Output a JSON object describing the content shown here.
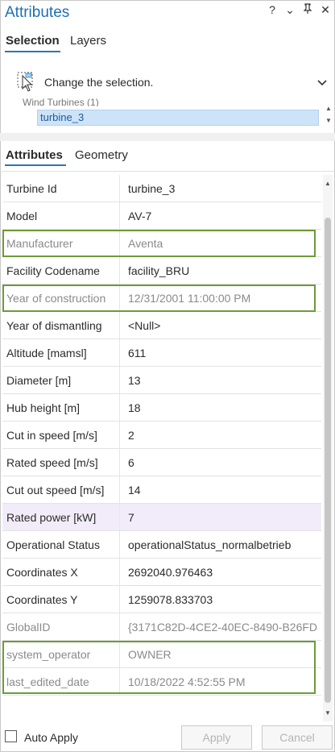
{
  "panel": {
    "title": "Attributes",
    "title_icons": [
      "help-icon",
      "dropdown-icon",
      "pin-icon",
      "close-icon"
    ],
    "help_symbol": "?",
    "dropdown_symbol": "⌄",
    "pin_symbol": "⊓",
    "close_symbol": "✕"
  },
  "top_tabs": [
    {
      "label": "Selection",
      "active": true
    },
    {
      "label": "Layers",
      "active": false
    }
  ],
  "selection": {
    "change_label": "Change the selection.",
    "chevron": "⌄",
    "tree_parent": "Wind Turbines (1)",
    "tree_child": "turbine_3"
  },
  "sub_tabs": [
    {
      "label": "Attributes",
      "active": true
    },
    {
      "label": "Geometry",
      "active": false
    }
  ],
  "attributes": [
    {
      "name": "Turbine Id",
      "value": "turbine_3",
      "readonly": false
    },
    {
      "name": "Model",
      "value": "AV-7",
      "readonly": false
    },
    {
      "name": "Manufacturer",
      "value": "Aventa",
      "readonly": true
    },
    {
      "name": "Facility Codename",
      "value": "facility_BRU",
      "readonly": false
    },
    {
      "name": "Year of construction",
      "value": "12/31/2001 11:00:00 PM",
      "readonly": true
    },
    {
      "name": "Year of dismantling",
      "value": "<Null>",
      "readonly": false
    },
    {
      "name": "Altitude [mamsl]",
      "value": "611",
      "readonly": false
    },
    {
      "name": "Diameter [m]",
      "value": "13",
      "readonly": false
    },
    {
      "name": "Hub height [m]",
      "value": "18",
      "readonly": false
    },
    {
      "name": "Cut in speed [m/s]",
      "value": "2",
      "readonly": false
    },
    {
      "name": "Rated speed [m/s]",
      "value": "6",
      "readonly": false
    },
    {
      "name": "Cut out speed [m/s]",
      "value": "14",
      "readonly": false
    },
    {
      "name": "Rated power [kW]",
      "value": "7",
      "readonly": false
    },
    {
      "name": "Operational Status",
      "value": "operationalStatus_normalbetrieb",
      "readonly": false
    },
    {
      "name": "Coordinates X",
      "value": "2692040.976463",
      "readonly": false
    },
    {
      "name": "Coordinates Y",
      "value": "1259078.833703",
      "readonly": false
    },
    {
      "name": "GlobalID",
      "value": "{3171C82D-4CE2-40EC-8490-B26FD",
      "readonly": true
    },
    {
      "name": "system_operator",
      "value": "OWNER",
      "readonly": true
    },
    {
      "name": "last_edited_date",
      "value": "10/18/2022 4:52:55 PM",
      "readonly": true
    }
  ],
  "highlight_row_index": 12,
  "footer": {
    "auto_apply_label": "Auto Apply",
    "auto_apply_checked": false,
    "apply_label": "Apply",
    "cancel_label": "Cancel"
  },
  "colors": {
    "title": "#1e6fb5",
    "tab_underline": "#2f74b5",
    "annotation_box": "#6d9a3a",
    "selected_row": "#f2ecfa",
    "tree_selection": "#cde3f7"
  }
}
